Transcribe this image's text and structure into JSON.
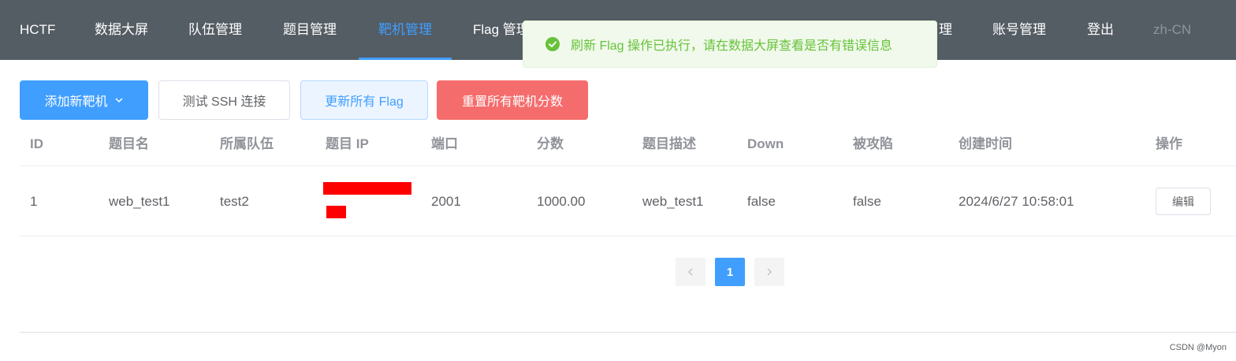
{
  "nav": {
    "brand": "HCTF",
    "items": [
      "数据大屏",
      "队伍管理",
      "题目管理",
      "靶机管理",
      "Flag 管理",
      "理",
      "账号管理",
      "登出"
    ],
    "active": "靶机管理",
    "lang": "zh-CN"
  },
  "toast": {
    "type": "success",
    "message": "刷新 Flag 操作已执行，请在数据大屏查看是否有错误信息"
  },
  "toolbar": {
    "add_label": "添加新靶机",
    "test_ssh_label": "测试 SSH 连接",
    "update_flag_label": "更新所有 Flag",
    "reset_score_label": "重置所有靶机分数"
  },
  "table": {
    "columns": [
      "ID",
      "题目名",
      "所属队伍",
      "题目 IP",
      "端口",
      "分数",
      "题目描述",
      "Down",
      "被攻陷",
      "创建时间",
      "操作"
    ],
    "rows": [
      {
        "id": "1",
        "name": "web_test1",
        "team": "test2",
        "ip": "",
        "port": "2001",
        "score": "1000.00",
        "desc": "web_test1",
        "down": "false",
        "pwned": "false",
        "created": "2024/6/27 10:58:01",
        "action": "编辑"
      }
    ]
  },
  "pagination": {
    "current": "1",
    "prev_icon": "chevron-left-icon",
    "next_icon": "chevron-right-icon"
  },
  "watermark": "CSDN @Myon⁠",
  "colors": {
    "nav_bg": "#545c64",
    "primary": "#409eff",
    "danger": "#f56c6c",
    "success": "#67c23a",
    "redaction": "#ff0000"
  }
}
